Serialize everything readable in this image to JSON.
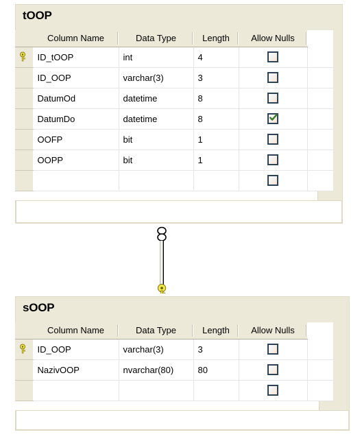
{
  "diagram": {
    "background_color": "#ffffff",
    "panel_color": "#ece9d8",
    "grid_color": "#ffffff",
    "checkbox_border_color": "#2b4257",
    "check_color": "#3a7a27",
    "key_color": "#f2ea48"
  },
  "columns_header": {
    "column_name": "Column Name",
    "data_type": "Data Type",
    "length": "Length",
    "allow_nulls": "Allow Nulls"
  },
  "tables": [
    {
      "name": "tOOP",
      "rows": [
        {
          "key": true,
          "column_name": "ID_tOOP",
          "data_type": "int",
          "length": "4",
          "allow_nulls": false
        },
        {
          "key": false,
          "column_name": "ID_OOP",
          "data_type": "varchar(3)",
          "length": "3",
          "allow_nulls": false
        },
        {
          "key": false,
          "column_name": "DatumOd",
          "data_type": "datetime",
          "length": "8",
          "allow_nulls": false
        },
        {
          "key": false,
          "column_name": "DatumDo",
          "data_type": "datetime",
          "length": "8",
          "allow_nulls": true
        },
        {
          "key": false,
          "column_name": "OOFP",
          "data_type": "bit",
          "length": "1",
          "allow_nulls": false
        },
        {
          "key": false,
          "column_name": "OOPP",
          "data_type": "bit",
          "length": "1",
          "allow_nulls": false
        },
        {
          "key": false,
          "column_name": "",
          "data_type": "",
          "length": "",
          "allow_nulls": false
        }
      ]
    },
    {
      "name": "sOOP",
      "rows": [
        {
          "key": true,
          "column_name": "ID_OOP",
          "data_type": "varchar(3)",
          "length": "3",
          "allow_nulls": false
        },
        {
          "key": false,
          "column_name": "NazivOOP",
          "data_type": "nvarchar(80)",
          "length": "80",
          "allow_nulls": false
        },
        {
          "key": false,
          "column_name": "",
          "data_type": "",
          "length": "",
          "allow_nulls": false
        }
      ]
    }
  ],
  "relationship": {
    "many_end_symbol": "infinity",
    "one_end_symbol": "key",
    "from_table": "tOOP",
    "to_table": "sOOP"
  }
}
